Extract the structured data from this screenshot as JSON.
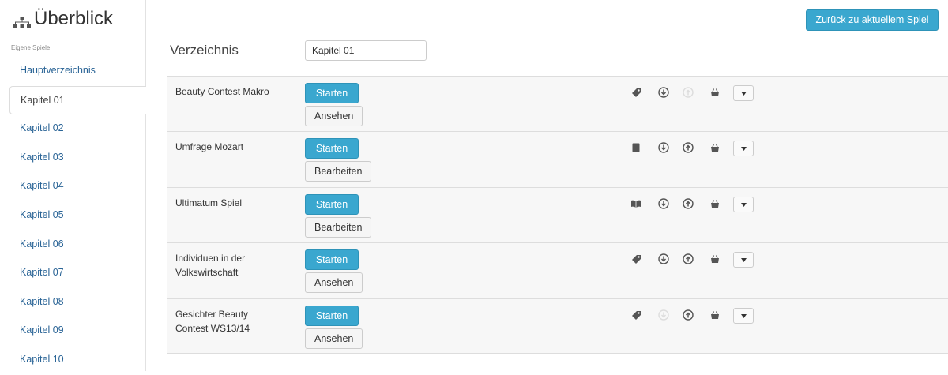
{
  "sidebar": {
    "brand_icon": "sitemap-icon",
    "title": "Überblick",
    "heading": "Eigene Spiele",
    "items": [
      {
        "label": "Hauptverzeichnis",
        "active": false
      },
      {
        "label": "Kapitel 01",
        "active": true
      },
      {
        "label": "Kapitel 02",
        "active": false
      },
      {
        "label": "Kapitel 03",
        "active": false
      },
      {
        "label": "Kapitel 04",
        "active": false
      },
      {
        "label": "Kapitel 05",
        "active": false
      },
      {
        "label": "Kapitel 06",
        "active": false
      },
      {
        "label": "Kapitel 07",
        "active": false
      },
      {
        "label": "Kapitel 08",
        "active": false
      },
      {
        "label": "Kapitel 09",
        "active": false
      },
      {
        "label": "Kapitel 10",
        "active": false
      }
    ]
  },
  "header": {
    "back_button": "Zurück zu aktuellem Spiel"
  },
  "directory": {
    "label": "Verzeichnis",
    "value": "Kapitel 01"
  },
  "colors": {
    "accent": "#3aa7cf",
    "link": "#2a6496",
    "row_bg": "#f7f7f7"
  },
  "games": [
    {
      "title": "Beauty Contest Makro",
      "start_label": "Starten",
      "secondary_label": "Ansehen",
      "icons": [
        "tag-icon",
        "download-icon",
        "upload-icon-disabled",
        "basket-icon"
      ]
    },
    {
      "title": "Umfrage Mozart",
      "start_label": "Starten",
      "secondary_label": "Bearbeiten",
      "icons": [
        "book-icon",
        "download-icon",
        "upload-icon",
        "basket-icon"
      ]
    },
    {
      "title": "Ultimatum Spiel",
      "start_label": "Starten",
      "secondary_label": "Bearbeiten",
      "icons": [
        "open-book-icon",
        "download-icon",
        "upload-icon",
        "basket-icon"
      ]
    },
    {
      "title": "Individuen in der Volkswirtschaft",
      "start_label": "Starten",
      "secondary_label": "Ansehen",
      "icons": [
        "tag-icon",
        "download-icon",
        "upload-icon",
        "basket-icon"
      ]
    },
    {
      "title": "Gesichter Beauty Contest WS13/14",
      "start_label": "Starten",
      "secondary_label": "Ansehen",
      "icons": [
        "tag-icon",
        "download-icon-disabled",
        "upload-icon",
        "basket-icon"
      ]
    }
  ]
}
